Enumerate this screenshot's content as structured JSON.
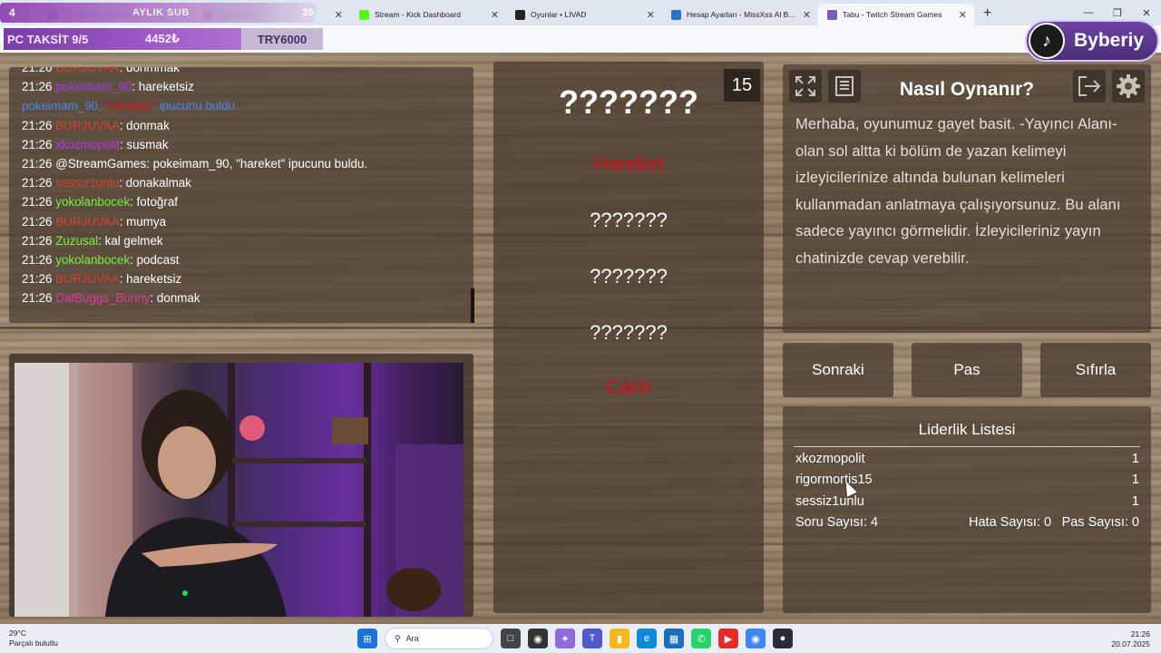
{
  "browser": {
    "tabs": [
      {
        "title": "(2) Discord | @Aleyna",
        "color": "#5865f2"
      },
      {
        "title": "Instagram",
        "color": "#d6249f"
      },
      {
        "title": "Stream - Kick Dashboard",
        "color": "#53fc18"
      },
      {
        "title": "Oyunlar • LIVAD",
        "color": "#222222"
      },
      {
        "title": "Hesap Ayarları - MissXss Al Bo...",
        "color": "#2a74c9"
      },
      {
        "title": "Tabu - Twitch Stream Games",
        "color": "#7a5fb0"
      }
    ],
    "new_tab": "+"
  },
  "overlay": {
    "count_left": "4",
    "label": "AYLIK SUB",
    "count_right": "25",
    "taksit": "PC TAKSİT 9/5",
    "taksit_amount": "4452₺",
    "try_amount": "TRY6000",
    "badge": "Byberiy"
  },
  "chat": [
    {
      "time": "21:26",
      "user": "BURJUVAA",
      "user_color": "#d9412f",
      "msg": ": donmmak"
    },
    {
      "time": "21:26",
      "user": "pokeimam_90",
      "user_color": "#a23be6",
      "msg": ": hareketsiz"
    },
    {
      "system": true,
      "user": "pokeimam_90",
      "quoted": "\"Hareket\"",
      "msg": " ipucunu buldu."
    },
    {
      "time": "21:26",
      "user": "BURJUVAA",
      "user_color": "#d9412f",
      "msg": ": donmak"
    },
    {
      "time": "21:26",
      "user": "xkozmopolit",
      "user_color": "#b13ae8",
      "msg": ": susmak"
    },
    {
      "time": "21:26",
      "user": "@StreamGames",
      "user_color": "#ffffff",
      "msg": ": pokeimam_90, \"hareket\" ipucunu buldu."
    },
    {
      "time": "21:26",
      "user": "sessiz1unlu",
      "user_color": "#d9412f",
      "msg": ": donakalmak"
    },
    {
      "time": "21:26",
      "user": "yokolanbocek",
      "user_color": "#7cf03a",
      "msg": ": fotoğraf"
    },
    {
      "time": "21:26",
      "user": "BURJUVAA",
      "user_color": "#d9412f",
      "msg": ": mumya"
    },
    {
      "time": "21:26",
      "user": "Zuzusal",
      "user_color": "#7cf03a",
      "msg": ": kal gelmek"
    },
    {
      "time": "21:26",
      "user": "yokolanbocek",
      "user_color": "#7cf03a",
      "msg": ": podcast"
    },
    {
      "time": "21:26",
      "user": "BURJUVAA",
      "user_color": "#d9412f",
      "msg": ": hareketsiz"
    },
    {
      "time": "21:26",
      "user": "DafBuggs_Bunny",
      "user_color": "#e23aa3",
      "msg": ": donmak"
    }
  ],
  "game": {
    "timer": "15",
    "main_word": "???????",
    "taboo_words": [
      {
        "text": "Hareket",
        "revealed": true
      },
      {
        "text": "???????",
        "revealed": false
      },
      {
        "text": "???????",
        "revealed": false
      },
      {
        "text": "???????",
        "revealed": false
      },
      {
        "text": "Canlı",
        "revealed": true
      }
    ]
  },
  "info": {
    "title": "Nasıl Oynanır?",
    "text": "Merhaba, oyunumuz gayet basit. -Yayıncı Alanı- olan sol altta ki bölüm de yazan kelimeyi izleyicilerinize altında bulunan kelimeleri kullanmadan anlatmaya çalışıyorsunuz. Bu alanı sadece yayıncı görmelidir. İzleyicileriniz yayın chatinizde cevap verebilir."
  },
  "buttons": {
    "next": "Sonraki",
    "pass": "Pas",
    "reset": "Sıfırla"
  },
  "leaderboard": {
    "title": "Liderlik Listesi",
    "rows": [
      {
        "name": "xkozmopolit",
        "score": "1"
      },
      {
        "name": "rigormortis15",
        "score": "1"
      },
      {
        "name": "sessiz1unlu",
        "score": "1"
      }
    ],
    "question_count": "Soru Sayısı: 4",
    "error_count": "Hata Sayısı: 0",
    "pass_count": "Pas Sayısı: 0"
  },
  "taskbar": {
    "temp": "29°C",
    "weather": "Parçalı bulutlu",
    "search": "Ara",
    "time": "21:26",
    "date": "20.07.2025"
  }
}
